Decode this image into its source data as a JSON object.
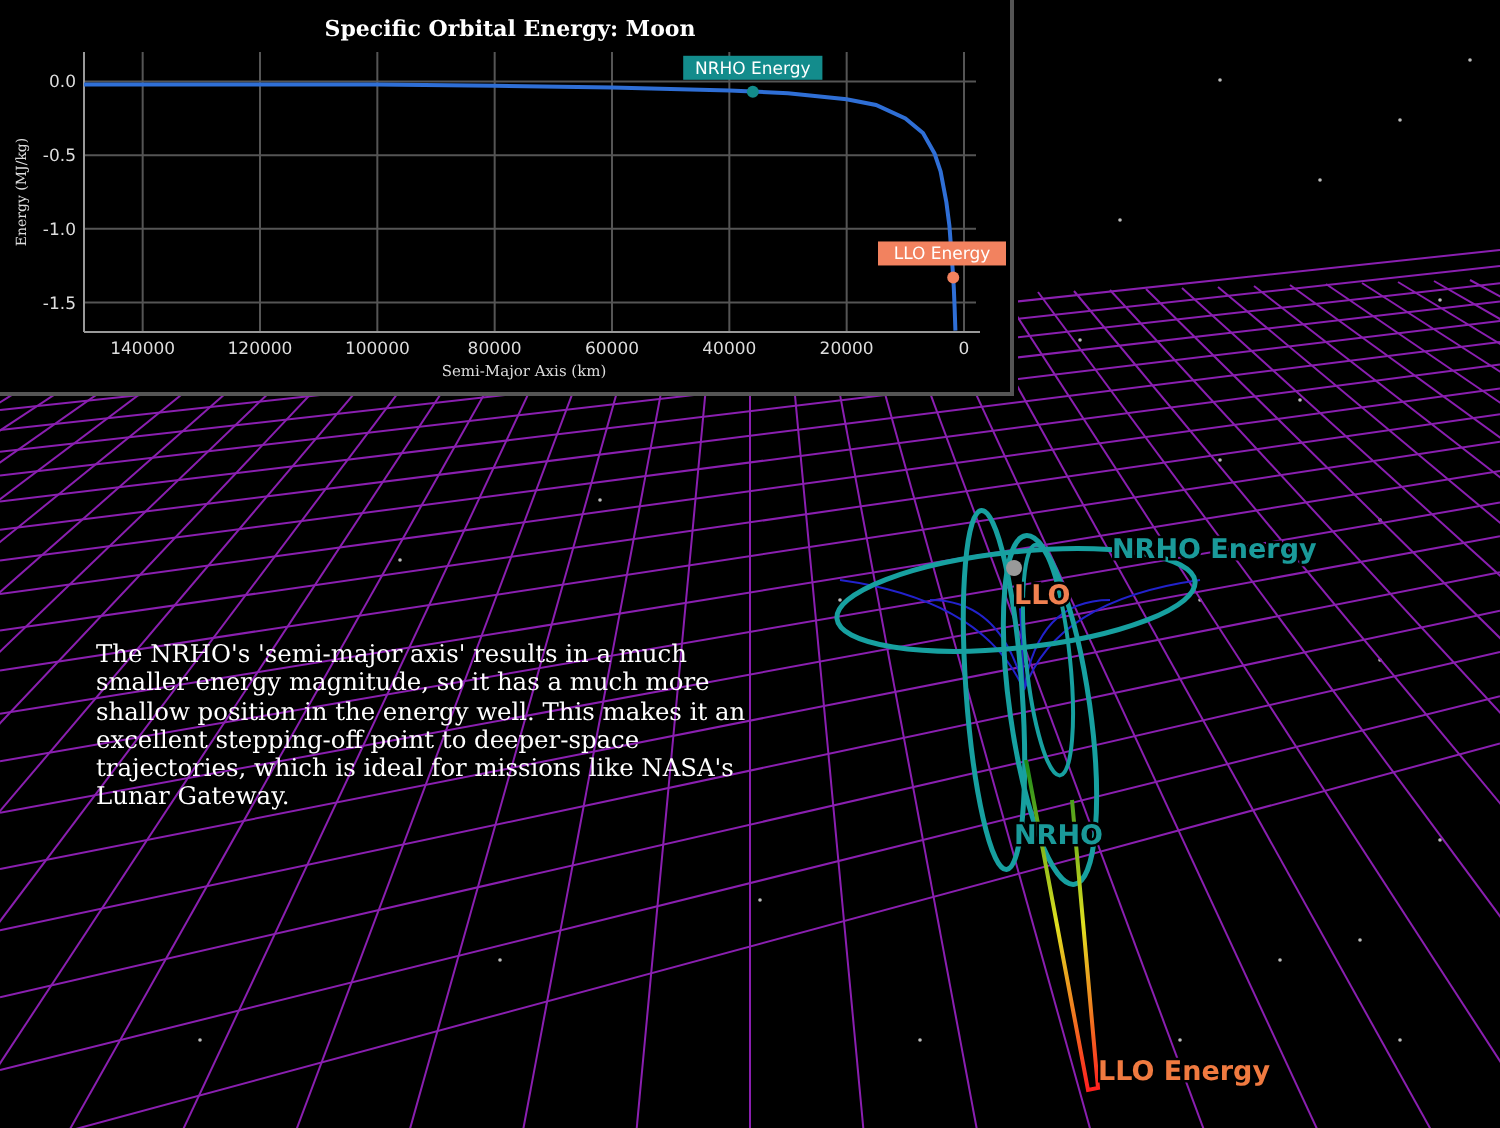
{
  "chart_panel": {
    "chart_data": {
      "type": "line",
      "title": "Specific Orbital Energy: Moon",
      "xlabel": "Semi-Major Axis (km)",
      "ylabel": "Energy (MJ/kg)",
      "x": [
        150000,
        120000,
        100000,
        80000,
        60000,
        40000,
        30000,
        20000,
        15000,
        10000,
        7000,
        5000,
        4000,
        3000,
        2500,
        2000,
        1837,
        1750,
        1600,
        1450
      ],
      "series": [
        {
          "color": "#2f6fd6",
          "values": [
            -0.02,
            -0.02,
            -0.02,
            -0.03,
            -0.04,
            -0.06,
            -0.08,
            -0.12,
            -0.16,
            -0.25,
            -0.35,
            -0.49,
            -0.61,
            -0.82,
            -0.98,
            -1.23,
            -1.33,
            -1.4,
            -1.53,
            -1.69
          ]
        }
      ],
      "grid": true,
      "xlim": [
        150000,
        0
      ],
      "ylim": [
        -1.7,
        0.2
      ],
      "xticks": [
        140000,
        120000,
        100000,
        80000,
        60000,
        40000,
        20000,
        0
      ],
      "yticks": [
        {
          "value": 0,
          "label": "0.0"
        },
        {
          "value": -0.5,
          "label": "-0.5"
        },
        {
          "value": -1,
          "label": "-1.0"
        },
        {
          "value": -1.5,
          "label": "-1.5"
        }
      ],
      "annotations": [
        {
          "text": "NRHO Energy",
          "x": 36000,
          "y": -0.07
        },
        {
          "text": "LLO Energy",
          "x": 1837,
          "y": -1.33
        }
      ]
    }
  },
  "scene": {
    "labels": [
      {
        "text": "NRHO Energy",
        "color": "#1a9a9a"
      },
      {
        "text": "LLO",
        "color": "#f08050"
      },
      {
        "text": "NRHO",
        "color": "#1a9a9a"
      },
      {
        "text": "LLO Energy",
        "color": "#f07a40"
      }
    ]
  },
  "caption": "The NRHO's 'semi-major axis' results in a much smaller energy magnitude, so it has a much more shallow position in the energy well. This makes it an excellent stepping-off point to deeper-space trajectories, which is ideal for missions like NASA's Lunar Gateway."
}
